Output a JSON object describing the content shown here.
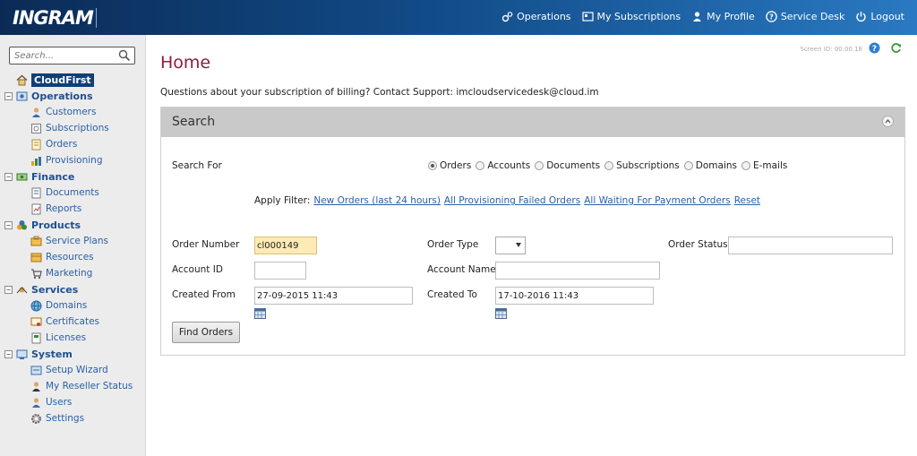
{
  "header": {
    "logo": "INGRAM",
    "nav": [
      {
        "label": "Operations",
        "icon": "operations-gear-icon"
      },
      {
        "label": "My Subscriptions",
        "icon": "subscriptions-icon"
      },
      {
        "label": "My Profile",
        "icon": "profile-icon"
      },
      {
        "label": "Service Desk",
        "icon": "help-icon"
      },
      {
        "label": "Logout",
        "icon": "power-icon"
      }
    ]
  },
  "sidebar": {
    "search_placeholder": "Search...",
    "root": "CloudFirst",
    "groups": [
      {
        "label": "Operations",
        "items": [
          "Customers",
          "Subscriptions",
          "Orders",
          "Provisioning"
        ]
      },
      {
        "label": "Finance",
        "items": [
          "Documents",
          "Reports"
        ]
      },
      {
        "label": "Products",
        "items": [
          "Service Plans",
          "Resources",
          "Marketing"
        ]
      },
      {
        "label": "Services",
        "items": [
          "Domains",
          "Certificates",
          "Licenses"
        ]
      },
      {
        "label": "System",
        "items": [
          "Setup Wizard",
          "My Reseller Status",
          "Users",
          "Settings"
        ]
      }
    ]
  },
  "main": {
    "screen_id": "Screen ID: 00.00.18",
    "title": "Home",
    "support": "Questions about your subscription of billing? Contact Support: imcloudservicedesk@cloud.im",
    "panel": {
      "title": "Search",
      "search_for_label": "Search For",
      "options": [
        "Orders",
        "Accounts",
        "Documents",
        "Subscriptions",
        "Domains",
        "E-mails"
      ],
      "selected": "Orders",
      "apply_filter_label": "Apply Filter:",
      "filters": [
        "New Orders (last 24 hours)",
        "All Provisioning Failed Orders",
        "All Waiting For Payment Orders",
        "Reset"
      ],
      "order_number_label": "Order Number",
      "order_number_value": "cl000149",
      "order_type_label": "Order Type",
      "order_status_label": "Order Status",
      "account_id_label": "Account ID",
      "account_name_label": "Account Name",
      "created_from_label": "Created From",
      "created_from_value": "27-09-2015 11:43",
      "created_to_label": "Created To",
      "created_to_value": "17-10-2016 11:43",
      "button": "Find Orders"
    }
  }
}
